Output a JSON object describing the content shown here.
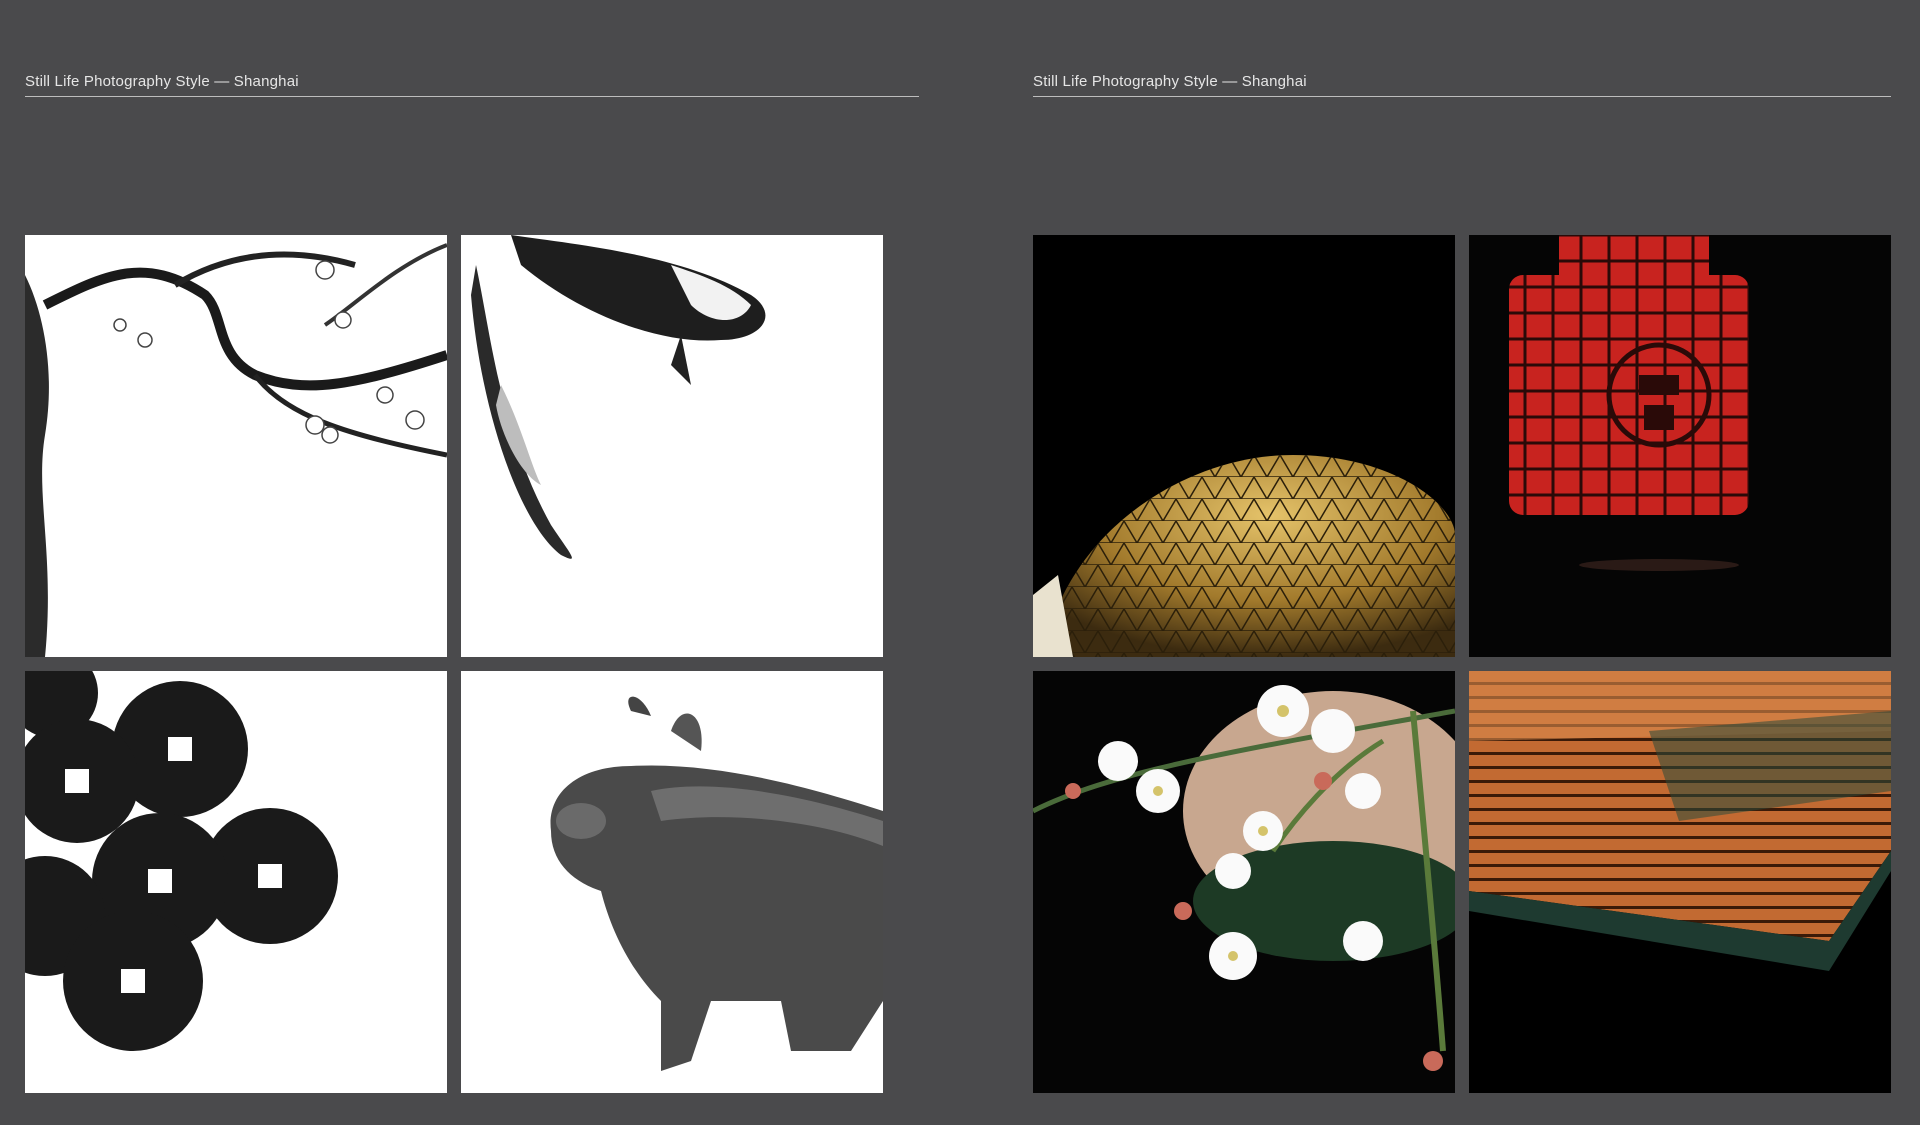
{
  "spreads": [
    {
      "header": "Still Life Photography Style — Shanghai",
      "photos": [
        "plum-blossom-ink-painting",
        "koi-fish-ink-painting",
        "ancient-chinese-coins",
        "bronze-ox-vessel"
      ]
    },
    {
      "header": "Still Life Photography Style — Shanghai",
      "photos": [
        "golden-geodesic-dome",
        "red-lantern-tea-caddy",
        "plum-blossoms-with-bowl",
        "bamboo-slip-book"
      ]
    }
  ],
  "colors": {
    "background": "#4a4a4c",
    "header_text": "#e6e6e6",
    "rule": "#bdbdbd"
  }
}
